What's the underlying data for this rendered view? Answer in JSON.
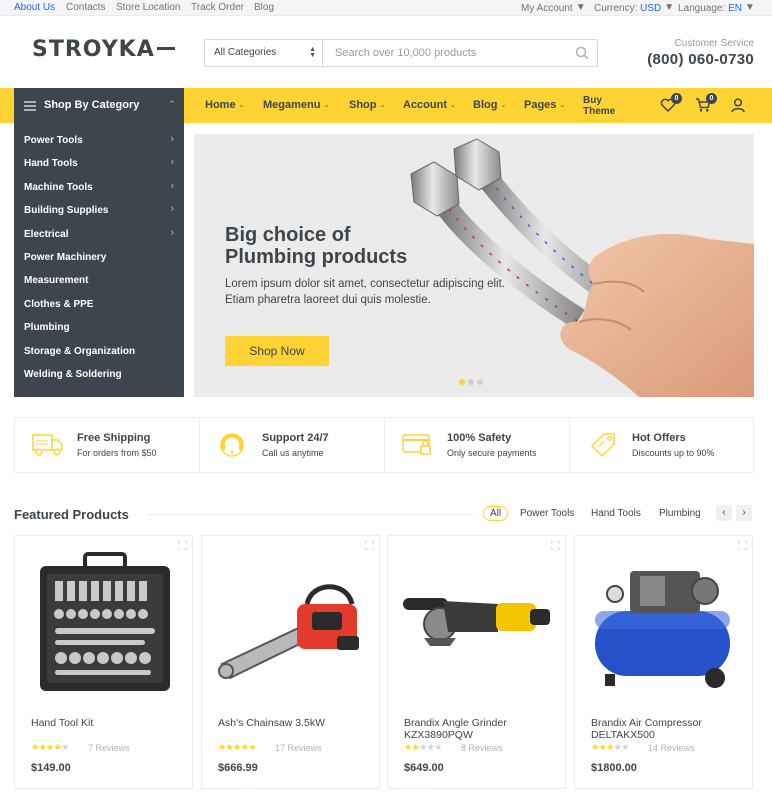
{
  "topbar": {
    "links": [
      "About Us",
      "Contacts",
      "Store Location",
      "Track Order",
      "Blog"
    ],
    "account": "My Account",
    "currency_label": "Currency:",
    "currency_value": "USD",
    "language_label": "Language:",
    "language_value": "EN"
  },
  "header": {
    "logo": "STROYKA",
    "search_category": "All Categories",
    "search_placeholder": "Search over 10,000 products",
    "service_label": "Customer Service",
    "service_phone": "(800) 060-0730"
  },
  "nav": {
    "category_button": "Shop By Category",
    "items": [
      "Home",
      "Megamenu",
      "Shop",
      "Account",
      "Blog",
      "Pages"
    ],
    "buy_line1": "Buy",
    "buy_line2": "Theme",
    "wishlist_count": "0",
    "cart_count": "0"
  },
  "categories": [
    "Power Tools",
    "Hand Tools",
    "Machine Tools",
    "Building Supplies",
    "Electrical",
    "Power Machinery",
    "Measurement",
    "Clothes & PPE",
    "Plumbing",
    "Storage & Organization",
    "Welding & Soldering"
  ],
  "hero": {
    "title_line1": "Big choice of",
    "title_line2": "Plumbing products",
    "text_line1": "Lorem ipsum dolor sit amet, consectetur adipiscing elit.",
    "text_line2": "Etiam pharetra laoreet dui quis molestie.",
    "button": "Shop Now",
    "active_slide": 1,
    "slide_count": 3
  },
  "features": [
    {
      "title": "Free Shipping",
      "subtitle": "For orders from $50",
      "icon": "truck-icon"
    },
    {
      "title": "Support 24/7",
      "subtitle": "Call us anytime",
      "icon": "support-24-icon"
    },
    {
      "title": "100% Safety",
      "subtitle": "Only secure payments",
      "icon": "card-lock-icon"
    },
    {
      "title": "Hot Offers",
      "subtitle": "Discounts up to 90%",
      "icon": "tag-icon"
    }
  ],
  "featured": {
    "title": "Featured Products",
    "tabs": [
      "All",
      "Power Tools",
      "Hand Tools",
      "Plumbing"
    ],
    "prev": "‹",
    "next": "›",
    "products": [
      {
        "name": "Hand Tool Kit",
        "rating": 4,
        "reviews": "7 Reviews",
        "price": "$149.00"
      },
      {
        "name": "Ash's Chainsaw 3.5kW",
        "rating": 5,
        "reviews": "17 Reviews",
        "price": "$666.99"
      },
      {
        "name": "Brandix Angle Grinder KZX3890PQW",
        "rating": 2,
        "reviews": "8 Reviews",
        "price": "$649.00"
      },
      {
        "name": "Brandix Air Compressor DELTAKX500",
        "rating": 3,
        "reviews": "14 Reviews",
        "price": "$1800.00"
      }
    ]
  },
  "colors": {
    "accent": "#ffd333",
    "dark": "#3d464d",
    "link": "#1a66ff"
  }
}
